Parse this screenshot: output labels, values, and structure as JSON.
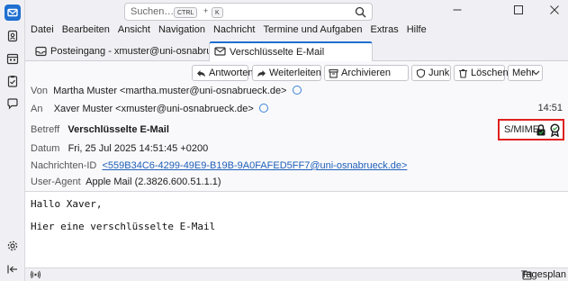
{
  "app": {
    "accent": "#1f6fd1",
    "rail_icons": [
      "mail-icon",
      "address-book-icon",
      "calendar-icon",
      "tasks-icon",
      "chat-icon",
      "settings-icon",
      "collapse-icon"
    ]
  },
  "search": {
    "placeholder": "Suchen…",
    "shortcut_mod": "CTRL",
    "shortcut_plus": "+",
    "shortcut_key": "K"
  },
  "menu": [
    "Datei",
    "Bearbeiten",
    "Ansicht",
    "Navigation",
    "Nachricht",
    "Termine und Aufgaben",
    "Extras",
    "Hilfe"
  ],
  "tabs": [
    {
      "label": "Posteingang - xmuster@uni-osnabrueck...",
      "icon": "inbox-icon",
      "active": false
    },
    {
      "label": "Verschlüsselte E-Mail",
      "icon": "envelope-icon",
      "active": true
    }
  ],
  "toolbar": {
    "reply": "Antworten",
    "forward": "Weiterleiten",
    "archive": "Archivieren",
    "junk": "Junk",
    "delete": "Löschen",
    "more": "Mehr"
  },
  "message": {
    "from_label": "Von",
    "from_value": "Martha Muster <martha.muster@uni-osnabrueck.de>",
    "to_label": "An",
    "to_value": "Xaver Muster <xmuster@uni-osnabrueck.de>",
    "time": "14:51",
    "subject_label": "Betreff",
    "subject_value": "Verschlüsselte E-Mail",
    "date_label": "Datum",
    "date_value": "Fri, 25 Jul 2025 14:51:45 +0200",
    "msgid_label": "Nachrichten-ID",
    "msgid_value": "<559B34C6-4299-49E9-B19B-9A0FAFED5FF7@uni-osnabrueck.de>",
    "useragent_label": "User-Agent",
    "useragent_value": "Apple Mail (2.3826.600.51.1.1)",
    "smime_label": "S/MIME",
    "smime_highlight_color": "#e02020"
  },
  "body": {
    "line1": "Hallo Xaver,",
    "line2": "Hier eine verschlüsselte E-Mail"
  },
  "status": {
    "today_pane": "Tagesplan"
  }
}
